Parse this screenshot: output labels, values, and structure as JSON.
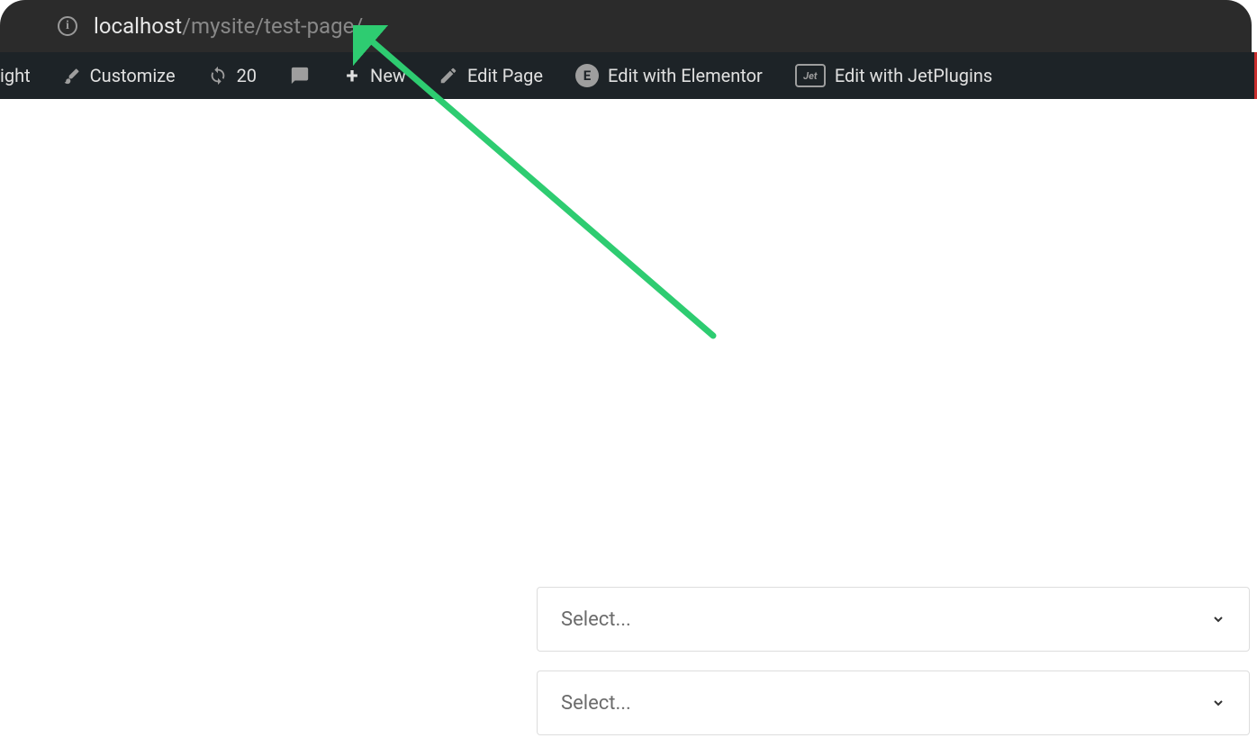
{
  "browser": {
    "url_host": "localhost",
    "url_path": "/mysite/test-page/"
  },
  "admin_bar": {
    "partial_item": "ight",
    "customize": "Customize",
    "updates_count": "20",
    "new": "New",
    "edit_page": "Edit Page",
    "edit_elementor": "Edit with Elementor",
    "edit_jetplugins": "Edit with JetPlugins",
    "jet_icon_text": "Jet",
    "elementor_icon_text": "E"
  },
  "selects": {
    "placeholder_1": "Select...",
    "placeholder_2": "Select..."
  },
  "colors": {
    "arrow": "#2ecc71"
  }
}
